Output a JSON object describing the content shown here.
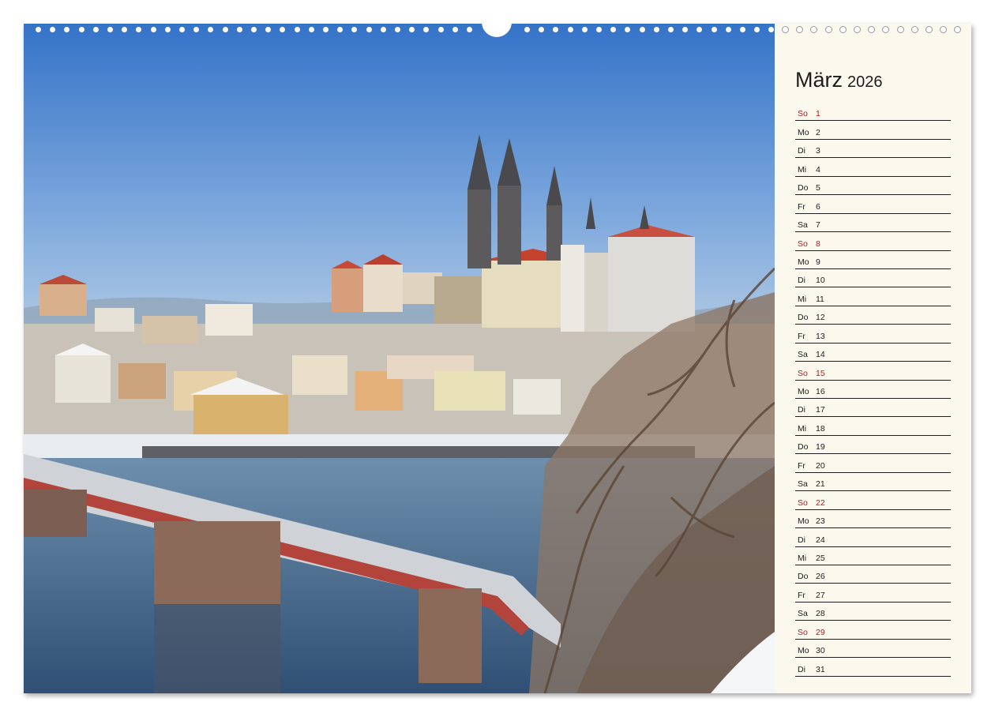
{
  "calendar": {
    "month": "März",
    "year": "2026",
    "days": [
      {
        "dn": "So",
        "num": "1",
        "sunday": true
      },
      {
        "dn": "Mo",
        "num": "2",
        "sunday": false
      },
      {
        "dn": "Di",
        "num": "3",
        "sunday": false
      },
      {
        "dn": "Mi",
        "num": "4",
        "sunday": false
      },
      {
        "dn": "Do",
        "num": "5",
        "sunday": false
      },
      {
        "dn": "Fr",
        "num": "6",
        "sunday": false
      },
      {
        "dn": "Sa",
        "num": "7",
        "sunday": false
      },
      {
        "dn": "So",
        "num": "8",
        "sunday": true
      },
      {
        "dn": "Mo",
        "num": "9",
        "sunday": false
      },
      {
        "dn": "Di",
        "num": "10",
        "sunday": false
      },
      {
        "dn": "Mi",
        "num": "11",
        "sunday": false
      },
      {
        "dn": "Do",
        "num": "12",
        "sunday": false
      },
      {
        "dn": "Fr",
        "num": "13",
        "sunday": false
      },
      {
        "dn": "Sa",
        "num": "14",
        "sunday": false
      },
      {
        "dn": "So",
        "num": "15",
        "sunday": true
      },
      {
        "dn": "Mo",
        "num": "16",
        "sunday": false
      },
      {
        "dn": "Di",
        "num": "17",
        "sunday": false
      },
      {
        "dn": "Mi",
        "num": "18",
        "sunday": false
      },
      {
        "dn": "Do",
        "num": "19",
        "sunday": false
      },
      {
        "dn": "Fr",
        "num": "20",
        "sunday": false
      },
      {
        "dn": "Sa",
        "num": "21",
        "sunday": false
      },
      {
        "dn": "So",
        "num": "22",
        "sunday": true
      },
      {
        "dn": "Mo",
        "num": "23",
        "sunday": false
      },
      {
        "dn": "Di",
        "num": "24",
        "sunday": false
      },
      {
        "dn": "Mi",
        "num": "25",
        "sunday": false
      },
      {
        "dn": "Do",
        "num": "26",
        "sunday": false
      },
      {
        "dn": "Fr",
        "num": "27",
        "sunday": false
      },
      {
        "dn": "Sa",
        "num": "28",
        "sunday": false
      },
      {
        "dn": "So",
        "num": "29",
        "sunday": true
      },
      {
        "dn": "Mo",
        "num": "30",
        "sunday": false
      },
      {
        "dn": "Di",
        "num": "31",
        "sunday": false
      }
    ]
  },
  "colors": {
    "sunday": "#c0171c",
    "text": "#1c1c1c",
    "sidebar_bg": "#fbf8ee",
    "sky": "#3c7fd0"
  },
  "photo": {
    "icon": "landscape-photo"
  }
}
